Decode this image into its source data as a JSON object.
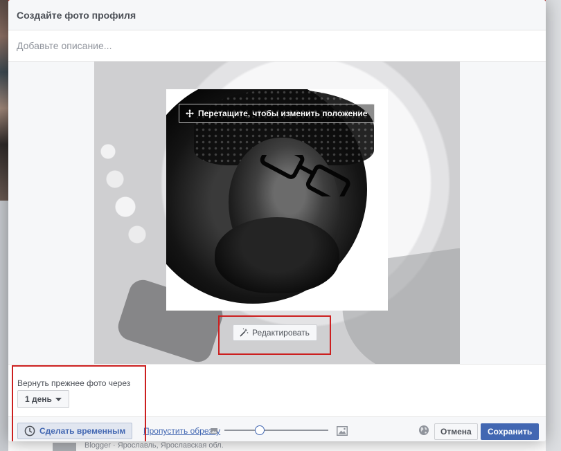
{
  "modal": {
    "title": "Создайте фото профиля",
    "description_placeholder": "Добавьте описание..."
  },
  "crop": {
    "drag_hint": "Перетащите, чтобы изменить положение",
    "drag_icon": "move-arrows-icon",
    "edit_label": "Редактировать",
    "edit_icon": "magic-wand-icon"
  },
  "temporary": {
    "label": "Вернуть прежнее фото через",
    "duration_value": "1 день",
    "duration_icon": "caret-down-icon"
  },
  "footer": {
    "make_temporary_label": "Сделать временным",
    "make_temporary_icon": "clock-icon",
    "skip_crop_label": "Пропустить обрезку",
    "zoom_level": 0.34,
    "zoom_icons": [
      "image-small-icon",
      "image-large-icon"
    ],
    "privacy_icon": "globe-icon",
    "cancel_label": "Отмена",
    "save_label": "Сохранить"
  },
  "background_page": {
    "footer_text": "Blogger · Ярославль, Ярославская обл."
  },
  "colors": {
    "accent": "#4267b2",
    "highlight": "#cc1f1f",
    "header_bg": "#f6f7f9",
    "border": "#ced0d4"
  }
}
